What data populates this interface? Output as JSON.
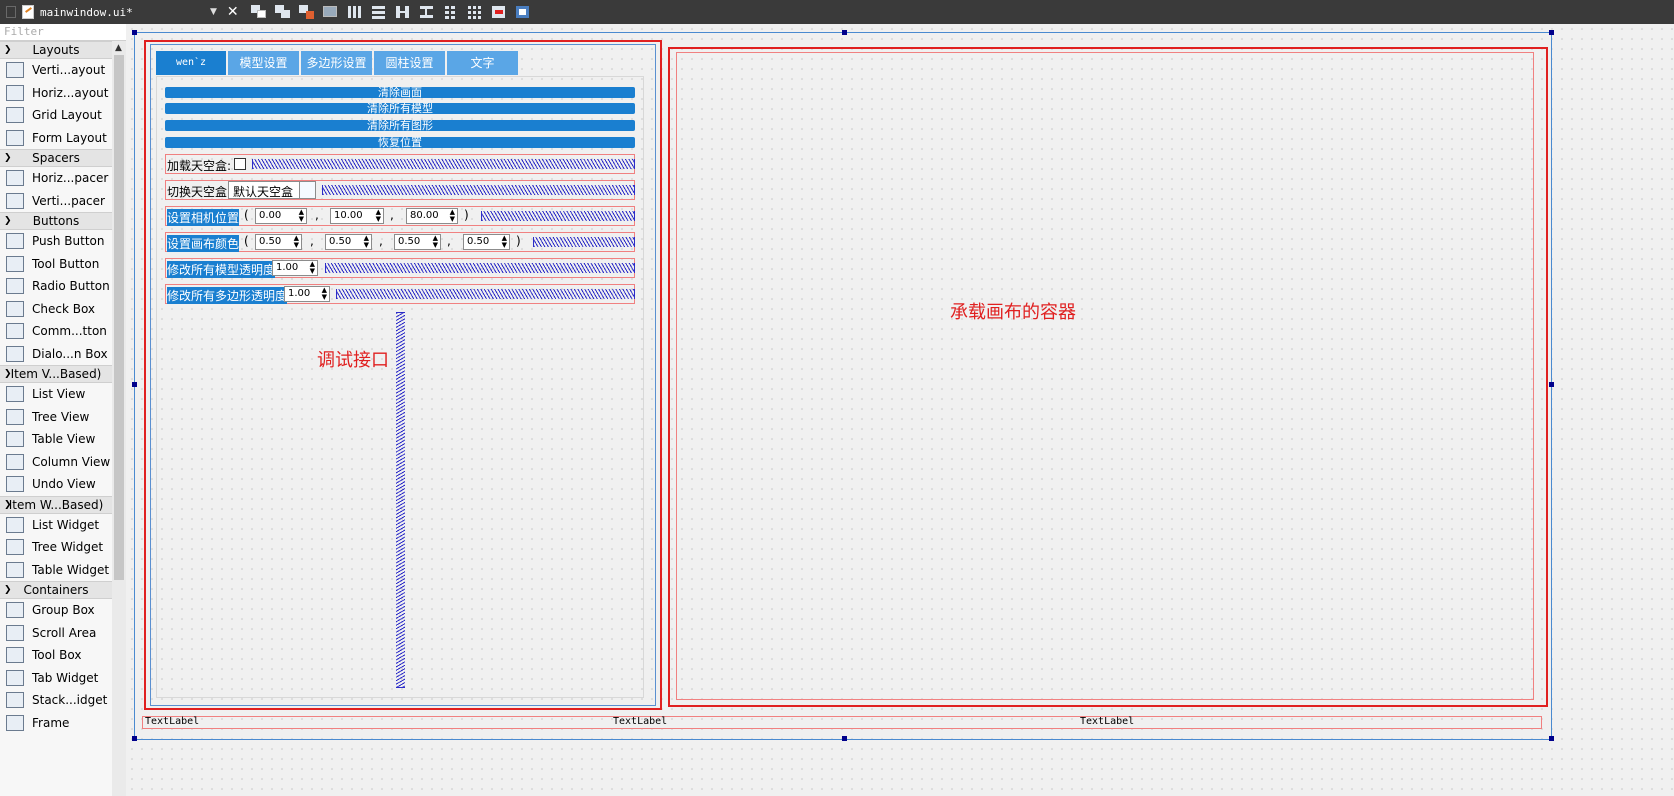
{
  "window": {
    "file_name": "mainwindow.ui*"
  },
  "filter": {
    "placeholder": "Filter"
  },
  "widget_box": {
    "categories": [
      {
        "label": "Layouts",
        "items": [
          "Verti...ayout",
          "Horiz...ayout",
          "Grid Layout",
          "Form Layout"
        ]
      },
      {
        "label": "Spacers",
        "items": [
          "Horiz...pacer",
          "Verti...pacer"
        ]
      },
      {
        "label": "Buttons",
        "items": [
          "Push Button",
          "Tool Button",
          "Radio Button",
          "Check Box",
          "Comm...tton",
          "Dialo...n Box"
        ]
      },
      {
        "label": "Item V...Based)",
        "items": [
          "List View",
          "Tree View",
          "Table View",
          "Column View",
          "Undo View"
        ]
      },
      {
        "label": "Item W...Based)",
        "items": [
          "List Widget",
          "Tree Widget",
          "Table Widget"
        ]
      },
      {
        "label": "Containers",
        "items": [
          "Group Box",
          "Scroll Area",
          "Tool Box",
          "Tab Widget",
          "Stack...idget",
          "Frame"
        ]
      }
    ]
  },
  "form": {
    "tabs": [
      "wen`z",
      "模型设置",
      "多边形设置",
      "圆柱设置",
      "文字"
    ],
    "buttons": [
      "清除画面",
      "清除所有模型",
      "清除所有图形",
      "恢复位置"
    ],
    "skybox": {
      "load_label": "加载天空盒:",
      "switch_label": "切换天空盒",
      "switch_value": "默认天空盒"
    },
    "camera": {
      "label": "设置相机位置",
      "open": "(",
      "sep": ",",
      "close": ")",
      "x": "0.00",
      "y": "10.00",
      "z": "80.00"
    },
    "color": {
      "label": "设置画布颜色",
      "open": "(",
      "sep": ",",
      "close": ")",
      "r": "0.50",
      "g": "0.50",
      "b": "0.50",
      "a": "0.50"
    },
    "model_opacity": {
      "label": "修改所有模型透明度",
      "value": "1.00"
    },
    "poly_opacity": {
      "label": "修改所有多边形透明度",
      "value": "1.00"
    },
    "annotations": {
      "debug": "调试接口",
      "container": "承载画布的容器"
    },
    "status_labels": [
      "TextLabel",
      "TextLabel",
      "TextLabel"
    ]
  }
}
